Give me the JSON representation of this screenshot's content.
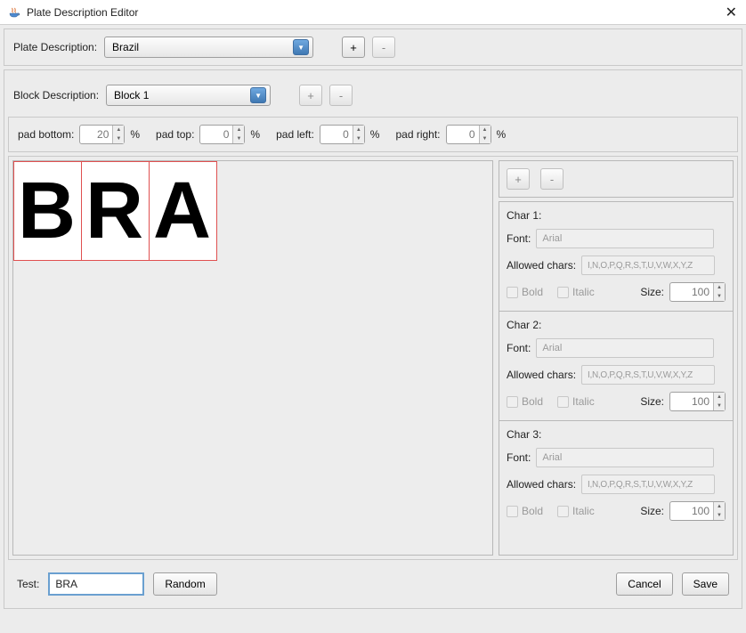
{
  "window": {
    "title": "Plate Description Editor"
  },
  "toolbar": {
    "plate_desc_label": "Plate Description:",
    "plate_desc_value": "Brazil",
    "add": "+",
    "remove": "-"
  },
  "block": {
    "desc_label": "Block Description:",
    "desc_value": "Block 1",
    "add": "+",
    "remove": "-"
  },
  "padding": {
    "bottom_label": "pad bottom:",
    "bottom_value": "20",
    "top_label": "pad top:",
    "top_value": "0",
    "left_label": "pad left:",
    "left_value": "0",
    "right_label": "pad right:",
    "right_value": "0",
    "unit": "%"
  },
  "preview": {
    "chars": [
      "B",
      "R",
      "A"
    ]
  },
  "char_controls": {
    "add": "+",
    "remove": "-"
  },
  "chars": [
    {
      "title": "Char 1:",
      "font_label": "Font:",
      "font_value": "Arial",
      "allowed_label": "Allowed chars:",
      "allowed_value": "I,N,O,P,Q,R,S,T,U,V,W,X,Y,Z",
      "bold": "Bold",
      "italic": "Italic",
      "size_label": "Size:",
      "size_value": "100"
    },
    {
      "title": "Char 2:",
      "font_label": "Font:",
      "font_value": "Arial",
      "allowed_label": "Allowed chars:",
      "allowed_value": "I,N,O,P,Q,R,S,T,U,V,W,X,Y,Z",
      "bold": "Bold",
      "italic": "Italic",
      "size_label": "Size:",
      "size_value": "100"
    },
    {
      "title": "Char 3:",
      "font_label": "Font:",
      "font_value": "Arial",
      "allowed_label": "Allowed chars:",
      "allowed_value": "I,N,O,P,Q,R,S,T,U,V,W,X,Y,Z",
      "bold": "Bold",
      "italic": "Italic",
      "size_label": "Size:",
      "size_value": "100"
    }
  ],
  "footer": {
    "test_label": "Test:",
    "test_value": "BRA",
    "random": "Random",
    "cancel": "Cancel",
    "save": "Save"
  }
}
